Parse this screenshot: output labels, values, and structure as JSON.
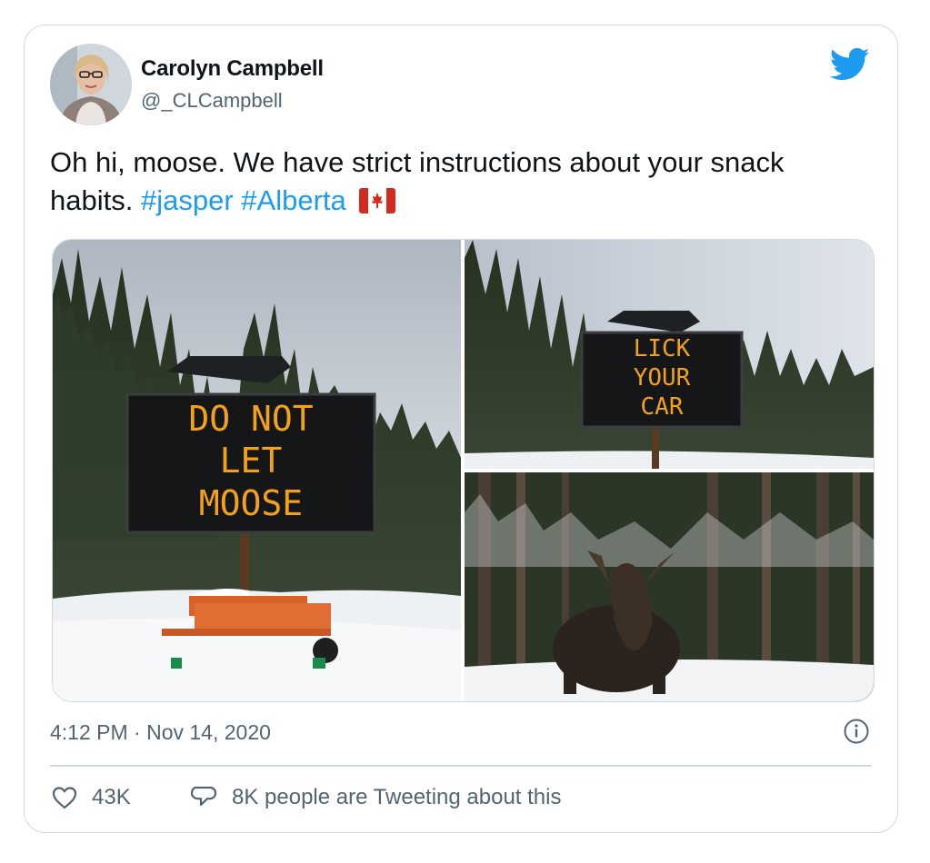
{
  "author": {
    "name": "Carolyn Campbell",
    "handle": "@_CLCampbell"
  },
  "tweet": {
    "text": "Oh hi, moose. We have strict instructions about your snack habits.",
    "hashtags": [
      "#jasper",
      "#Alberta"
    ]
  },
  "media": {
    "sign_left": [
      "DO NOT",
      "LET",
      "MOOSE"
    ],
    "sign_right": [
      "LICK",
      "YOUR",
      "CAR"
    ]
  },
  "timestamp": "4:12 PM · Nov 14, 2020",
  "actions": {
    "likes": "43K",
    "replies": "8K people are Tweeting about this"
  },
  "icons": {
    "brand": "twitter-bird-icon",
    "info": "info-icon",
    "like": "heart-icon",
    "reply": "speech-bubble-icon",
    "flag": "canada-flag-icon"
  },
  "colors": {
    "hashtag": "#1d9bf0",
    "bird": "#1d9bf0",
    "sign_text": "#f2a11a"
  }
}
